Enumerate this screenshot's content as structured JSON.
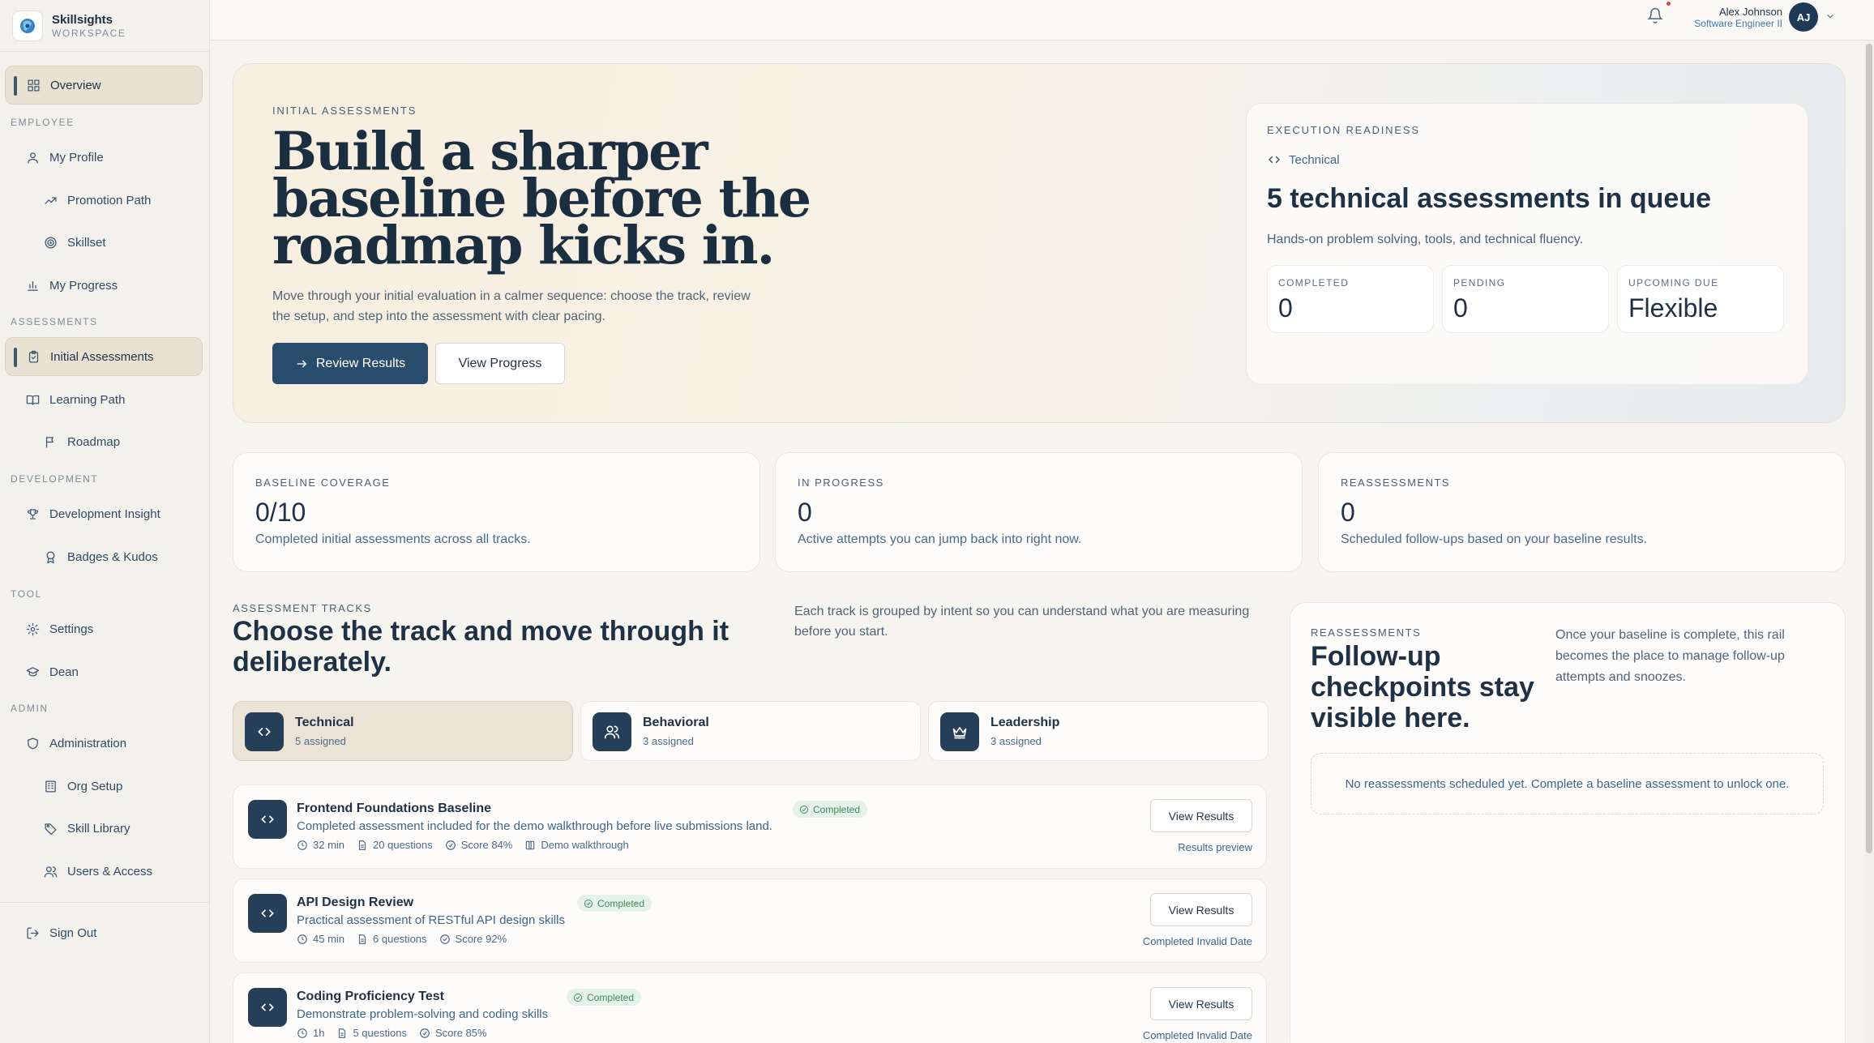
{
  "brand": {
    "name": "Skillsights",
    "sub": "WORKSPACE"
  },
  "sidebar": {
    "overview": "Overview",
    "sections": {
      "employee": "EMPLOYEE",
      "assessments": "ASSESSMENTS",
      "development": "DEVELOPMENT",
      "tool": "TOOL",
      "admin": "ADMIN"
    },
    "items": {
      "my_profile": "My Profile",
      "promotion_path": "Promotion Path",
      "skillset": "Skillset",
      "my_progress": "My Progress",
      "initial_assessments": "Initial Assessments",
      "learning_path": "Learning Path",
      "roadmap": "Roadmap",
      "development_insight": "Development Insight",
      "badges_kudos": "Badges & Kudos",
      "settings": "Settings",
      "dean": "Dean",
      "administration": "Administration",
      "org_setup": "Org Setup",
      "skill_library": "Skill Library",
      "users_access": "Users & Access",
      "sign_out": "Sign Out"
    }
  },
  "user": {
    "name": "Alex Johnson",
    "role": "Software Engineer II",
    "initials": "AJ"
  },
  "hero": {
    "eyebrow": "INITIAL ASSESSMENTS",
    "title": "Build a sharper baseline before the roadmap kicks in.",
    "description": "Move through your initial evaluation in a calmer sequence: choose the track, review the setup, and step into the assessment with clear pacing.",
    "primary_button": "Review Results",
    "secondary_button": "View Progress"
  },
  "readiness": {
    "eyebrow": "EXECUTION READINESS",
    "track": "Technical",
    "title": "5 technical assessments in queue",
    "description": "Hands-on problem solving, tools, and technical fluency.",
    "completed_label": "COMPLETED",
    "completed_value": "0",
    "pending_label": "PENDING",
    "pending_value": "0",
    "due_label": "UPCOMING DUE",
    "due_value": "Flexible"
  },
  "stats": [
    {
      "label": "BASELINE COVERAGE",
      "value": "0/10",
      "desc": "Completed initial assessments across all tracks."
    },
    {
      "label": "IN PROGRESS",
      "value": "0",
      "desc": "Active attempts you can jump back into right now."
    },
    {
      "label": "REASSESSMENTS",
      "value": "0",
      "desc": "Scheduled follow-ups based on your baseline results."
    }
  ],
  "tracks": {
    "eyebrow": "ASSESSMENT TRACKS",
    "title": "Choose the track and move through it deliberately.",
    "description": "Each track is grouped by intent so you can understand what you are measuring before you start.",
    "tabs": [
      {
        "name": "Technical",
        "count": "5 assigned"
      },
      {
        "name": "Behavioral",
        "count": "3 assigned"
      },
      {
        "name": "Leadership",
        "count": "3 assigned"
      }
    ]
  },
  "assessments": [
    {
      "name": "Frontend Foundations Baseline",
      "status": "Completed",
      "description": "Completed assessment included for the demo walkthrough before live submissions land.",
      "duration": "32 min",
      "questions": "20 questions",
      "score": "Score 84%",
      "extra": "Demo walkthrough",
      "button": "View Results",
      "note": "Results preview"
    },
    {
      "name": "API Design Review",
      "status": "Completed",
      "description": "Practical assessment of RESTful API design skills",
      "duration": "45 min",
      "questions": "6 questions",
      "score": "Score 92%",
      "button": "View Results",
      "note": "Completed Invalid Date"
    },
    {
      "name": "Coding Proficiency Test",
      "status": "Completed",
      "description": "Demonstrate problem-solving and coding skills",
      "duration": "1h",
      "questions": "5 questions",
      "score": "Score 85%",
      "button": "View Results",
      "note": "Completed Invalid Date"
    }
  ],
  "reassessments": {
    "eyebrow": "REASSESSMENTS",
    "title": "Follow-up checkpoints stay visible here.",
    "description": "Once your baseline is complete, this rail becomes the place to manage follow-up attempts and snoozes.",
    "empty": "No reassessments scheduled yet. Complete a baseline assessment to unlock one."
  },
  "colors": {
    "accent": "#2a4c6c",
    "icon_bg": "#263f58",
    "success": "#3f8a5a",
    "active_nav": "#e9e2d2"
  }
}
